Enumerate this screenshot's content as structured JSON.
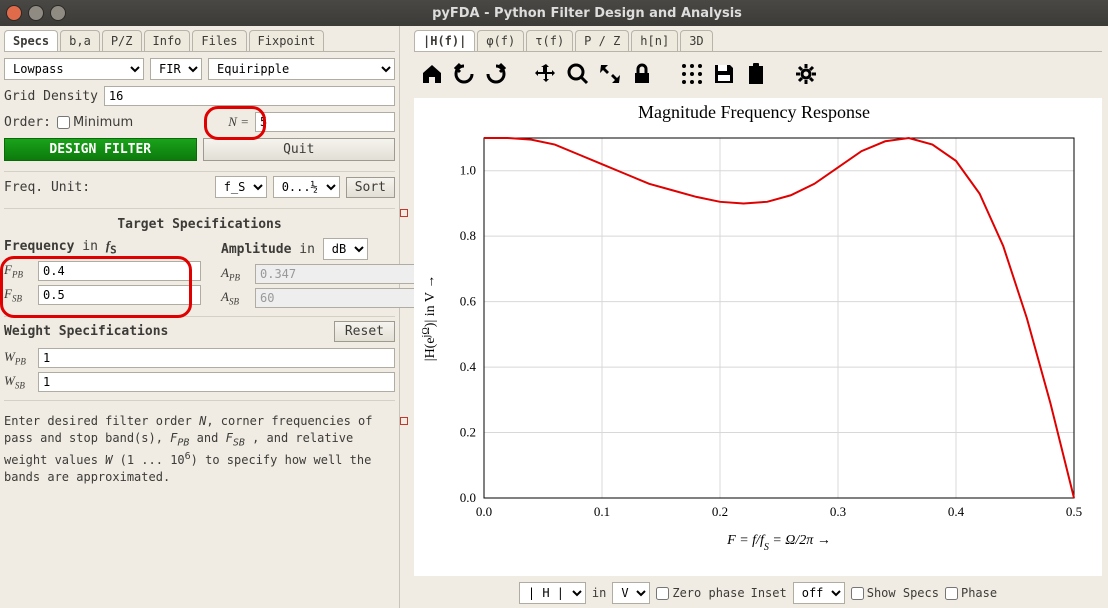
{
  "window": {
    "title": "pyFDA - Python Filter Design and Analysis"
  },
  "left_tabs": [
    "Specs",
    "b,a",
    "P/Z",
    "Info",
    "Files",
    "Fixpoint"
  ],
  "active_left_tab": 0,
  "filter": {
    "response": "Lowpass",
    "iirfir": "FIR",
    "algo": "Equiripple",
    "grid_density_label": "Grid Density",
    "grid_density": "16",
    "order_label": "Order:",
    "minimum_label": "Minimum",
    "minimum_checked": false,
    "n_label": "N =",
    "n_value": "5",
    "design_btn": "DESIGN FILTER",
    "quit_btn": "Quit"
  },
  "freq": {
    "unit_label": "Freq. Unit:",
    "unit": "f_S",
    "range": "0...½",
    "sort_btn": "Sort"
  },
  "target": {
    "title": "Target Specifications",
    "freq_hdr_a": "Frequency",
    "freq_hdr_b": " in ",
    "freq_hdr_c": "f",
    "freq_hdr_sub": "S",
    "amp_hdr": "Amplitude",
    "amp_hdr_in": " in ",
    "amp_unit": "dB",
    "f_pb_label": "F",
    "f_pb_sub": "PB",
    "f_pb": "0.4",
    "f_sb_label": "F",
    "f_sb_sub": "SB",
    "f_sb": "0.5",
    "a_pb_label": "A",
    "a_pb_sub": "PB",
    "a_pb": "0.347",
    "a_sb_label": "A",
    "a_sb_sub": "SB",
    "a_sb": "60"
  },
  "weight": {
    "title": "Weight Specifications",
    "reset_btn": "Reset",
    "w_pb_label": "W",
    "w_pb_sub": "PB",
    "w_pb": "1",
    "w_sb_label": "W",
    "w_sb_sub": "SB",
    "w_sb": "1"
  },
  "info_text_parts": {
    "a": "Enter desired filter order ",
    "b": ", corner frequencies of pass and stop band(s), ",
    "c": " and ",
    "d": " , and relative weight values ",
    "e": " (1 ... 10",
    "f": ") to specify how well the bands are approximated."
  },
  "right_tabs": [
    "|H(f)|",
    "φ(f)",
    "τ(f)",
    "P / Z",
    "h[n]",
    "3D"
  ],
  "active_right_tab": 0,
  "bottom": {
    "h_sel": "| H |",
    "in_label": "in",
    "v_sel": "V",
    "zero_phase": "Zero phase",
    "inset_label": "Inset",
    "inset_sel": "off",
    "show_specs": "Show Specs",
    "phase": "Phase"
  },
  "chart_data": {
    "type": "line",
    "title": "Magnitude Frequency Response",
    "xlabel": "F = f/f_S = Ω/2π →",
    "ylabel": "|H(e^{jΩ})| in V →",
    "xlim": [
      0.0,
      0.5
    ],
    "ylim": [
      0.0,
      1.1
    ],
    "xticks": [
      0.0,
      0.1,
      0.2,
      0.3,
      0.4,
      0.5
    ],
    "yticks": [
      0.0,
      0.2,
      0.4,
      0.6,
      0.8,
      1.0
    ],
    "x": [
      0.0,
      0.02,
      0.04,
      0.06,
      0.08,
      0.1,
      0.12,
      0.14,
      0.16,
      0.18,
      0.2,
      0.22,
      0.24,
      0.26,
      0.28,
      0.3,
      0.32,
      0.34,
      0.36,
      0.38,
      0.4,
      0.42,
      0.44,
      0.46,
      0.48,
      0.5
    ],
    "y": [
      1.1,
      1.1,
      1.095,
      1.08,
      1.05,
      1.02,
      0.99,
      0.96,
      0.94,
      0.92,
      0.905,
      0.9,
      0.905,
      0.925,
      0.96,
      1.01,
      1.06,
      1.09,
      1.1,
      1.08,
      1.03,
      0.93,
      0.77,
      0.55,
      0.29,
      0.0
    ]
  }
}
